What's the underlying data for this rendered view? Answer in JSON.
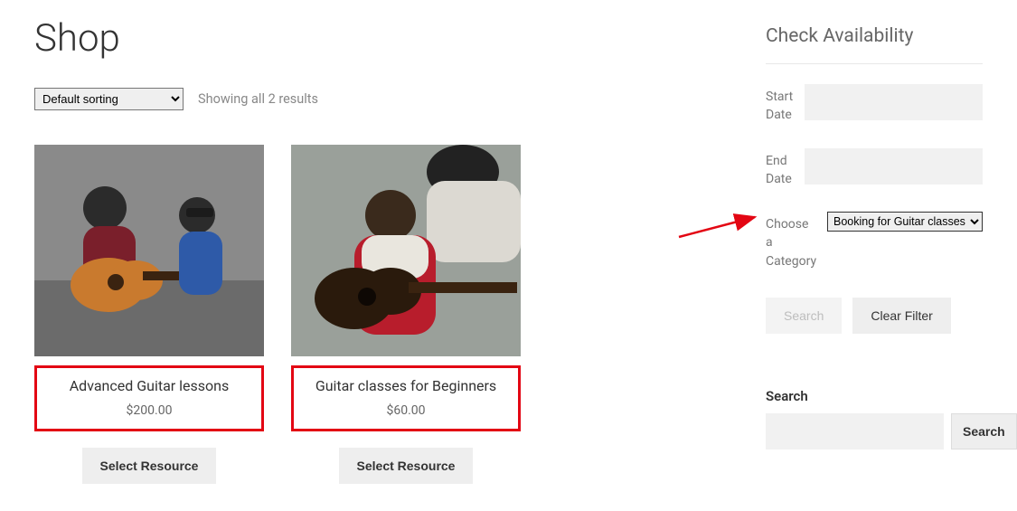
{
  "page": {
    "title": "Shop",
    "sorting": "Default sorting",
    "result_count": "Showing all 2 results"
  },
  "products": [
    {
      "title": "Advanced Guitar lessons",
      "price": "$200.00",
      "button": "Select Resource"
    },
    {
      "title": "Guitar classes for Beginners",
      "price": "$60.00",
      "button": "Select Resource"
    }
  ],
  "sidebar": {
    "availability_title": "Check Availability",
    "start_label": "Start Date",
    "end_label": "End Date",
    "category_label": "Choose a Category",
    "category_selected": "Booking for Guitar classes",
    "search_button": "Search",
    "clear_button": "Clear Filter",
    "search_widget_title": "Search",
    "search_submit": "Search"
  }
}
